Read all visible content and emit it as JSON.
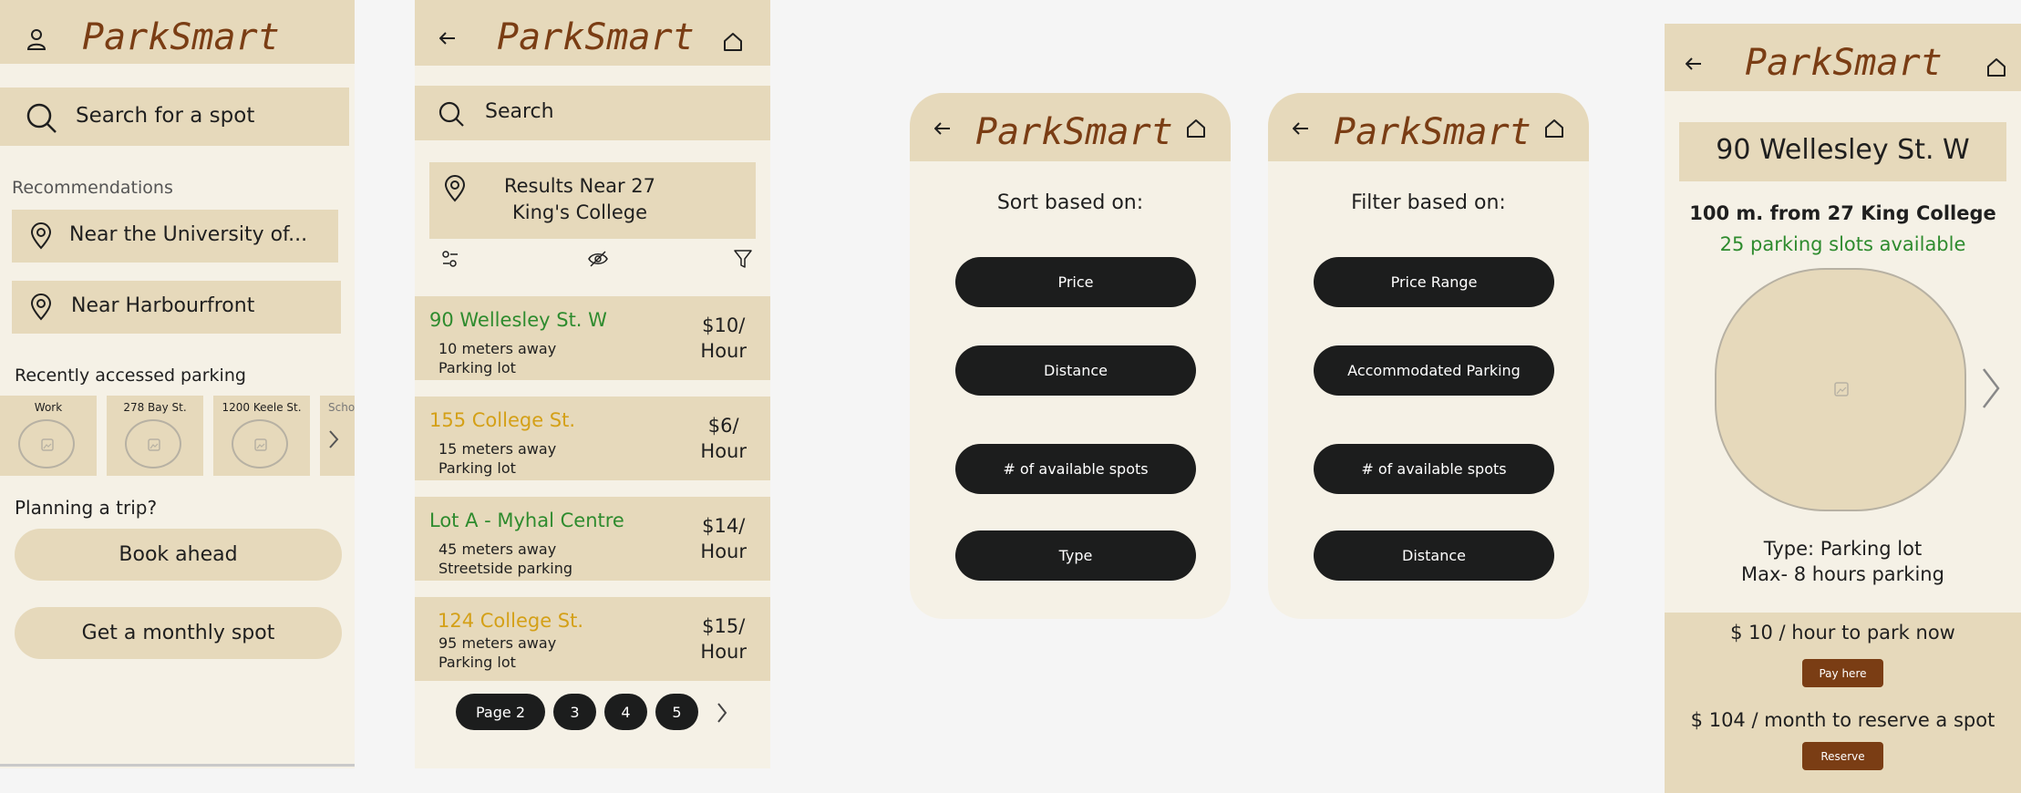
{
  "colors": {
    "cream": "#f5f1e6",
    "tan": "#e6d9bb",
    "brand": "#7a3d14",
    "dark": "#1c1d1d",
    "green": "#2e8b2e",
    "gold": "#d4a017"
  },
  "screen1": {
    "brand": "ParkSmart",
    "profile_icon": "person-icon",
    "search": {
      "placeholder": "Search for a spot"
    },
    "recommendations_label": "Recommendations",
    "recommendations": [
      {
        "label": "Near the University of..."
      },
      {
        "label": "Near Harbourfront"
      }
    ],
    "recent_label": "Recently accessed parking",
    "recent": [
      {
        "label": "Work"
      },
      {
        "label": "278 Bay St."
      },
      {
        "label": "1200 Keele St."
      },
      {
        "label": "Scho"
      }
    ],
    "planning_label": "Planning a trip?",
    "book_ahead": "Book ahead",
    "monthly": "Get a monthly spot"
  },
  "screen2": {
    "brand": "ParkSmart",
    "search": {
      "placeholder": "Search"
    },
    "results_near": "Results Near 27 King's College",
    "results": [
      {
        "name": "90 Wellesley St. W",
        "distance": "10 meters away",
        "type": "Parking lot",
        "price": "$10/",
        "unit": "Hour",
        "status": "green"
      },
      {
        "name": "155 College St.",
        "distance": "15 meters away",
        "type": "Parking lot",
        "price": "$6/",
        "unit": "Hour",
        "status": "gold"
      },
      {
        "name": "Lot A - Myhal Centre",
        "distance": "45 meters away",
        "type": "Streetside parking",
        "price": "$14/",
        "unit": "Hour",
        "status": "green"
      },
      {
        "name": "124 College St.",
        "distance": "95 meters away",
        "type": "Parking lot",
        "price": "$15/",
        "unit": "Hour",
        "status": "gold"
      }
    ],
    "pagination": {
      "current": "Page 2",
      "pages": [
        "3",
        "4",
        "5"
      ]
    }
  },
  "screen3": {
    "brand": "ParkSmart",
    "heading": "Sort based on:",
    "options": [
      "Price",
      "Distance",
      "# of available spots",
      "Type"
    ]
  },
  "screen4": {
    "brand": "ParkSmart",
    "heading": "Filter based on:",
    "options": [
      "Price Range",
      "Accommodated Parking",
      "# of available spots",
      "Distance"
    ]
  },
  "screen5": {
    "brand": "ParkSmart",
    "address": "90 Wellesley St. W",
    "distance_from": "100 m. from 27 King College",
    "available": "25 parking slots available",
    "type_line": "Type: Parking lot",
    "max_line": "Max- 8 hours parking",
    "hourly_price": "$ 10 / hour to park now",
    "pay_label": "Pay here",
    "monthly_price": "$ 104 / month to reserve a spot",
    "reserve_label": "Reserve"
  }
}
